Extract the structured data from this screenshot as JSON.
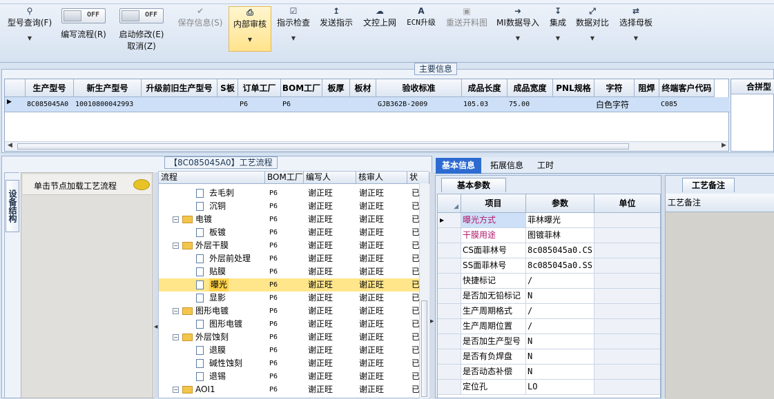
{
  "toolbar": {
    "items": [
      {
        "label": "型号查询(F)",
        "icon": "search-icon"
      },
      {
        "label": "编写流程(R)",
        "toggle": "OFF"
      },
      {
        "label": "启动修改(E)",
        "label2": "取消(Z)",
        "toggle": "OFF"
      },
      {
        "label": "保存信息(S)",
        "icon": "check-icon"
      },
      {
        "label": "内部审核",
        "icon": "printer-icon"
      },
      {
        "label": "指示检查",
        "icon": "checkbox-icon"
      },
      {
        "label": "发送指示",
        "icon": "upload-icon"
      },
      {
        "label": "文控上网",
        "icon": "cloud-upload-icon"
      },
      {
        "label": "ECN升级",
        "icon": "font-icon"
      },
      {
        "label": "重送开料图",
        "icon": "image-icon"
      },
      {
        "label": "MI数据导入",
        "icon": "sign-in-icon"
      },
      {
        "label": "集成",
        "icon": "download-icon"
      },
      {
        "label": "数据对比",
        "icon": "compress-icon"
      },
      {
        "label": "选择母板",
        "icon": "random-icon"
      }
    ]
  },
  "main_info": {
    "title": "主要信息",
    "columns": [
      "生产型号",
      "新生产型号",
      "升级前旧生产型号",
      "S板",
      "订单工厂",
      "BOM工厂",
      "板厚",
      "板材",
      "验收标准",
      "成品长度",
      "成品宽度",
      "PNL规格",
      "字符",
      "阻焊",
      "终端客户代码"
    ],
    "row": [
      "8C085045A0",
      "10010800042993",
      "",
      "",
      "P6",
      "P6",
      "",
      "",
      "GJB362B-2009",
      "105.03",
      "75.00",
      "",
      "白色字符",
      "",
      "C085"
    ],
    "right_header": "合拼型"
  },
  "process": {
    "title": "【8C085045A0】工艺流程",
    "side_tab": "设备结构",
    "hint": "单击节点加载工艺流程",
    "columns": [
      "流程",
      "BOM工厂",
      "编写人",
      "核审人",
      "状"
    ],
    "rows": [
      {
        "name": "去毛刺",
        "level": 2,
        "type": "doc",
        "factory": "P6",
        "writer": "谢正旺",
        "reviewer": "谢正旺",
        "status": "已"
      },
      {
        "name": "沉铜",
        "level": 2,
        "type": "doc",
        "factory": "P6",
        "writer": "谢正旺",
        "reviewer": "谢正旺",
        "status": "已"
      },
      {
        "name": "电镀",
        "level": 1,
        "type": "folder",
        "factory": "P6",
        "writer": "谢正旺",
        "reviewer": "谢正旺",
        "status": "已"
      },
      {
        "name": "板镀",
        "level": 2,
        "type": "doc",
        "factory": "P6",
        "writer": "谢正旺",
        "reviewer": "谢正旺",
        "status": "已"
      },
      {
        "name": "外层干膜",
        "level": 1,
        "type": "folder",
        "factory": "P6",
        "writer": "谢正旺",
        "reviewer": "谢正旺",
        "status": "已"
      },
      {
        "name": "外层前处理",
        "level": 2,
        "type": "doc",
        "factory": "P6",
        "writer": "谢正旺",
        "reviewer": "谢正旺",
        "status": "已"
      },
      {
        "name": "贴膜",
        "level": 2,
        "type": "doc",
        "factory": "P6",
        "writer": "谢正旺",
        "reviewer": "谢正旺",
        "status": "已"
      },
      {
        "name": "曝光",
        "level": 2,
        "type": "doc",
        "factory": "P6",
        "writer": "谢正旺",
        "reviewer": "谢正旺",
        "status": "已",
        "selected": true
      },
      {
        "name": "显影",
        "level": 2,
        "type": "doc",
        "factory": "P6",
        "writer": "谢正旺",
        "reviewer": "谢正旺",
        "status": "已"
      },
      {
        "name": "图形电镀",
        "level": 1,
        "type": "folder",
        "factory": "P6",
        "writer": "谢正旺",
        "reviewer": "谢正旺",
        "status": "已"
      },
      {
        "name": "图形电镀",
        "level": 2,
        "type": "doc",
        "factory": "P6",
        "writer": "谢正旺",
        "reviewer": "谢正旺",
        "status": "已"
      },
      {
        "name": "外层蚀刻",
        "level": 1,
        "type": "folder",
        "factory": "P6",
        "writer": "谢正旺",
        "reviewer": "谢正旺",
        "status": "已"
      },
      {
        "name": "退膜",
        "level": 2,
        "type": "doc",
        "factory": "P6",
        "writer": "谢正旺",
        "reviewer": "谢正旺",
        "status": "已"
      },
      {
        "name": "碱性蚀刻",
        "level": 2,
        "type": "doc",
        "factory": "P6",
        "writer": "谢正旺",
        "reviewer": "谢正旺",
        "status": "已"
      },
      {
        "name": "退锡",
        "level": 2,
        "type": "doc",
        "factory": "P6",
        "writer": "谢正旺",
        "reviewer": "谢正旺",
        "status": "已"
      },
      {
        "name": "AOI1",
        "level": 1,
        "type": "folder",
        "factory": "P6",
        "writer": "谢正旺",
        "reviewer": "谢正旺",
        "status": "已"
      }
    ]
  },
  "detail": {
    "tabs": [
      "基本信息",
      "拓展信息",
      "工时"
    ],
    "params_tab": "基本参数",
    "columns": [
      "项目",
      "参数",
      "单位"
    ],
    "rows": [
      {
        "item": "曝光方式",
        "value": "菲林曝光",
        "unit": "",
        "highlight": true
      },
      {
        "item": "干膜用途",
        "value": "图镀菲林",
        "unit": "",
        "highlight": true
      },
      {
        "item": "CS面菲林号",
        "value": "8c085045a0.CS",
        "unit": ""
      },
      {
        "item": "SS面菲林号",
        "value": "8c085045a0.SS",
        "unit": ""
      },
      {
        "item": "快捷标记",
        "value": "/",
        "unit": ""
      },
      {
        "item": "是否加无铅标记",
        "value": "N",
        "unit": ""
      },
      {
        "item": "生产周期格式",
        "value": "/",
        "unit": ""
      },
      {
        "item": "生产周期位置",
        "value": "/",
        "unit": ""
      },
      {
        "item": "是否加生产型号",
        "value": "N",
        "unit": ""
      },
      {
        "item": "是否有负焊盘",
        "value": "N",
        "unit": ""
      },
      {
        "item": "是否动态补偿",
        "value": "N",
        "unit": ""
      },
      {
        "item": "定位孔",
        "value": "LO",
        "unit": ""
      }
    ],
    "note_tab": "工艺备注",
    "note_header": "工艺备注"
  },
  "colors": {
    "highlight_text": "#b2186b",
    "selected_row": "#ffe68a",
    "accent": "#2d6bd0"
  }
}
